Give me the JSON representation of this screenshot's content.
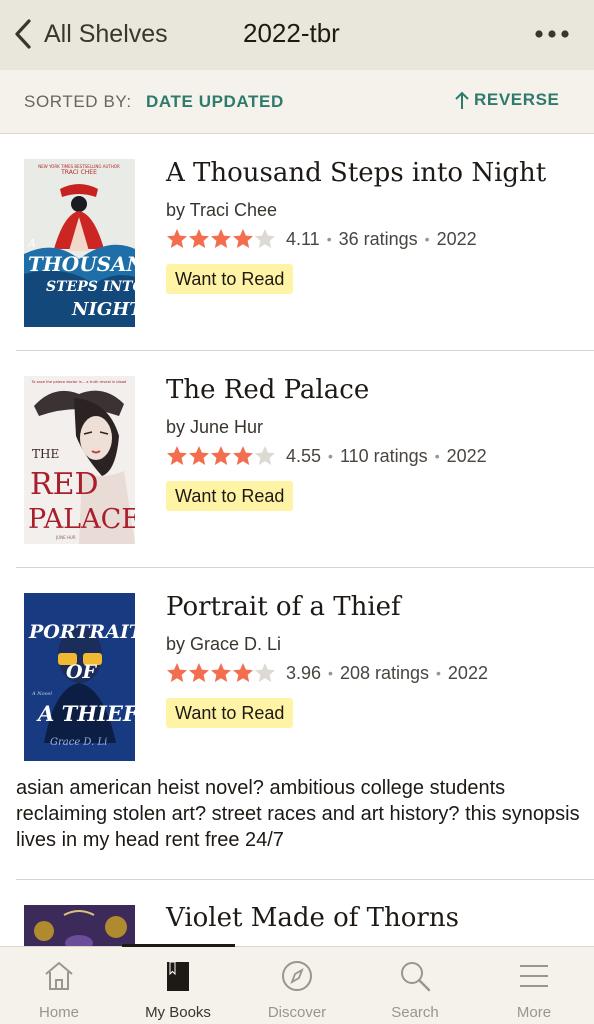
{
  "header": {
    "back_label": "All Shelves",
    "title": "2022-tbr"
  },
  "sort": {
    "label": "SORTED BY:",
    "value": "DATE UPDATED",
    "reverse_label": "REVERSE"
  },
  "books": [
    {
      "title": "A Thousand Steps into Night",
      "author": "by Traci Chee",
      "rating": "4.11",
      "ratings_count": "36 ratings",
      "year": "2022",
      "status": "Want to Read",
      "stars": 4,
      "cover_text": [
        "NEW YORK TIMES BESTSELLING AUTHOR",
        "TRACI CHEE",
        "A",
        "THOUSAND",
        "STEPS INTO",
        "NIGHT"
      ]
    },
    {
      "title": "The Red Palace",
      "author": "by June Hur",
      "rating": "4.55",
      "ratings_count": "110 ratings",
      "year": "2022",
      "status": "Want to Read",
      "stars": 4.5,
      "cover_text": [
        "To save the palace doctor is... a truth reveal in blood",
        "THE",
        "RED",
        "PALACE",
        "JUNE HUR"
      ]
    },
    {
      "title": "Portrait of a Thief",
      "author": "by Grace D. Li",
      "rating": "3.96",
      "ratings_count": "208 ratings",
      "year": "2022",
      "status": "Want to Read",
      "stars": 4,
      "review": "asian american heist novel? ambitious college students reclaiming stolen art? street races and art history? this synopsis lives in my head rent free 24/7",
      "cover_text": [
        "PORTRAIT",
        "OF",
        "A THIEF",
        "A Novel",
        "Grace D. Li"
      ]
    },
    {
      "title": "Violet Made of Thorns"
    }
  ],
  "nav": [
    {
      "label": "Home",
      "icon": "home-icon"
    },
    {
      "label": "My Books",
      "icon": "book-icon",
      "active": true
    },
    {
      "label": "Discover",
      "icon": "compass-icon"
    },
    {
      "label": "Search",
      "icon": "search-icon"
    },
    {
      "label": "More",
      "icon": "menu-icon"
    }
  ],
  "colors": {
    "header_bg": "#e9e6dc",
    "accent_teal": "#2f7a6d",
    "star_orange": "#f26e4f",
    "badge_yellow": "#fff3a6"
  }
}
